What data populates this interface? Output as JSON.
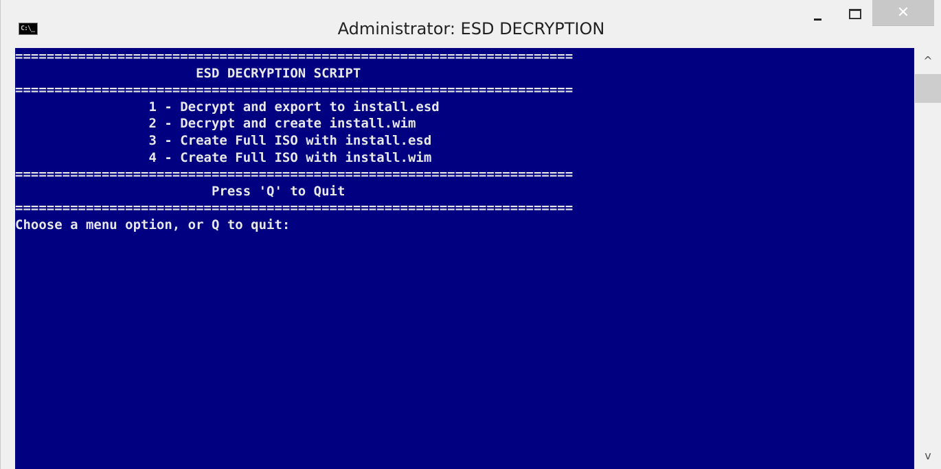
{
  "window": {
    "title": "Administrator:  ESD DECRYPTION",
    "icon_text": "C:\\_",
    "controls": {
      "minimize": "minimize-icon",
      "maximize": "maximize-icon",
      "close": "close-icon",
      "close_glyph": "✕"
    }
  },
  "console": {
    "background_color": "#000080",
    "text_color": "#e8e8e8",
    "lines": [
      "=======================================================================",
      "                       ESD DECRYPTION SCRIPT",
      "=======================================================================",
      "                 1 - Decrypt and export to install.esd",
      "                 2 - Decrypt and create install.wim",
      "                 3 - Create Full ISO with install.esd",
      "                 4 - Create Full ISO with install.wim",
      "=======================================================================",
      "                         Press 'Q' to Quit",
      "=======================================================================",
      "Choose a menu option, or Q to quit:"
    ]
  },
  "scrollbar": {
    "up_glyph": "^",
    "down_glyph": "v"
  }
}
